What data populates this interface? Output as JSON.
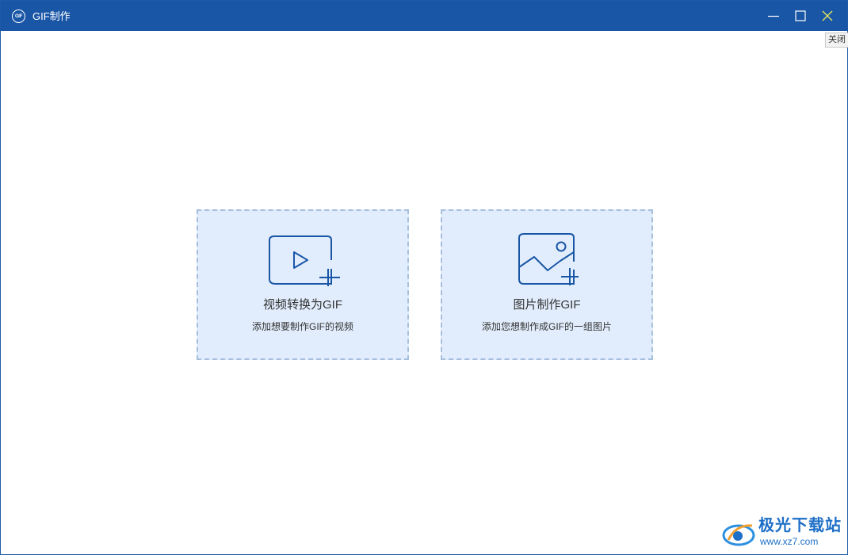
{
  "window": {
    "title": "GIF制作",
    "app_icon_text": "GIF",
    "close_tooltip": "关闭"
  },
  "cards": [
    {
      "title": "视频转换为GIF",
      "subtitle": "添加想要制作GIF的视频",
      "icon": "video-add-icon"
    },
    {
      "title": "图片制作GIF",
      "subtitle": "添加您想制作成GIF的一组图片",
      "icon": "image-add-icon"
    }
  ],
  "watermark": {
    "name": "极光下载站",
    "url": "www.xz7.com"
  },
  "colors": {
    "titlebar": "#1a56a6",
    "card_background": "#e1edfc",
    "card_border": "#a6bfdd",
    "icon_stroke": "#1a56a6",
    "watermark": "#1e6fc7"
  }
}
